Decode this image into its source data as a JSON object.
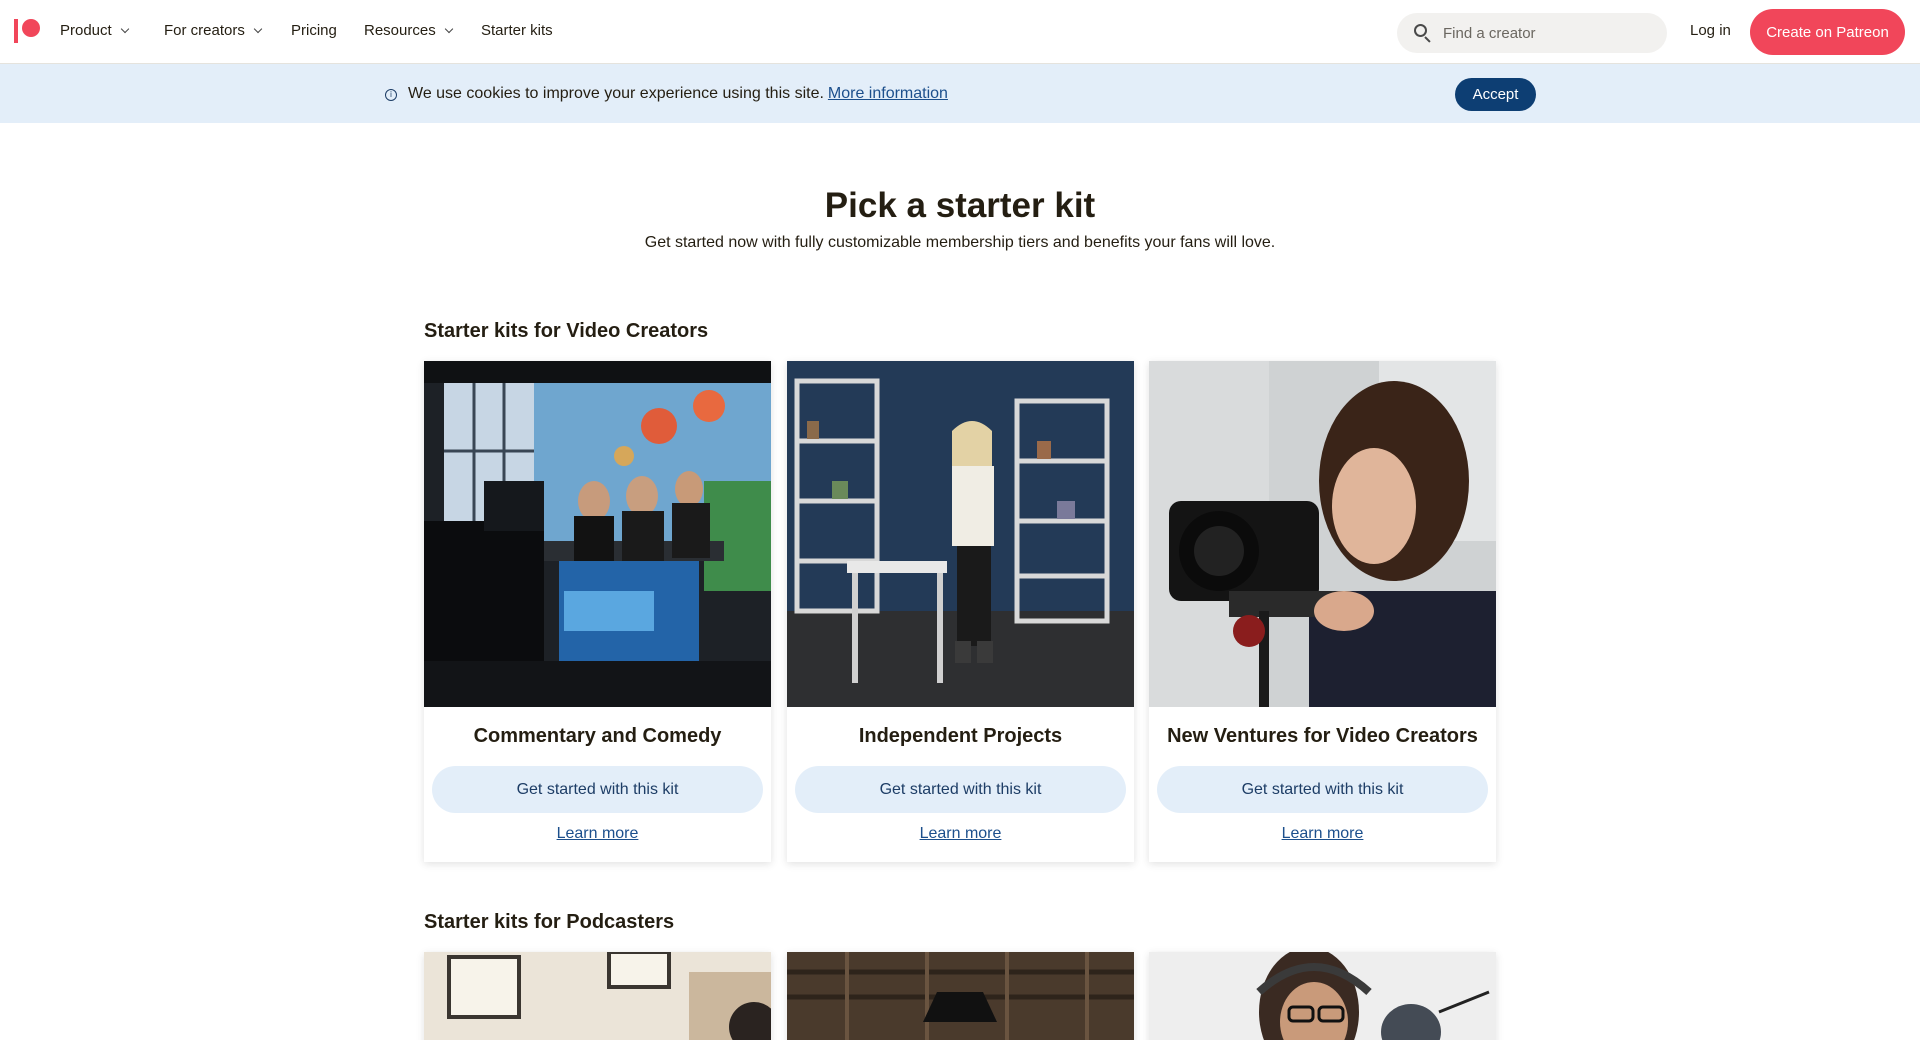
{
  "nav": {
    "items": [
      {
        "label": "Product",
        "dropdown": true
      },
      {
        "label": "For creators",
        "dropdown": true
      },
      {
        "label": "Pricing",
        "dropdown": false
      },
      {
        "label": "Resources",
        "dropdown": true
      },
      {
        "label": "Starter kits",
        "dropdown": false
      }
    ],
    "search_placeholder": "Find a creator",
    "login_label": "Log in",
    "create_label": "Create on Patreon",
    "brand_color": "#f1465a"
  },
  "cookie_banner": {
    "text": "We use cookies to improve your experience using this site.",
    "link_label": "More information",
    "accept_label": "Accept"
  },
  "hero": {
    "title": "Pick a starter kit",
    "subtitle": "Get started now with fully customizable membership tiers and benefits your fans will love."
  },
  "sections": [
    {
      "title": "Starter kits for Video Creators",
      "cards": [
        {
          "title": "Commentary and Comedy",
          "button_label": "Get started with this kit",
          "link_label": "Learn more",
          "image": "studio-podcast-photo"
        },
        {
          "title": "Independent Projects",
          "button_label": "Get started with this kit",
          "link_label": "Learn more",
          "image": "presenter-shelves-photo"
        },
        {
          "title": "New Ventures for Video Creators",
          "button_label": "Get started with this kit",
          "link_label": "Learn more",
          "image": "camera-operator-photo"
        }
      ]
    },
    {
      "title": "Starter kits for Podcasters",
      "cards": [
        {
          "image": "office-room-photo"
        },
        {
          "image": "warehouse-ceiling-photo"
        },
        {
          "image": "headphones-microphone-photo"
        }
      ]
    }
  ],
  "colors": {
    "accent": "#f1465a",
    "banner_bg": "#e3eef9",
    "accept_bg": "#0d3e73",
    "link": "#1c4f8c",
    "kit_button_bg": "#e3eef9"
  }
}
